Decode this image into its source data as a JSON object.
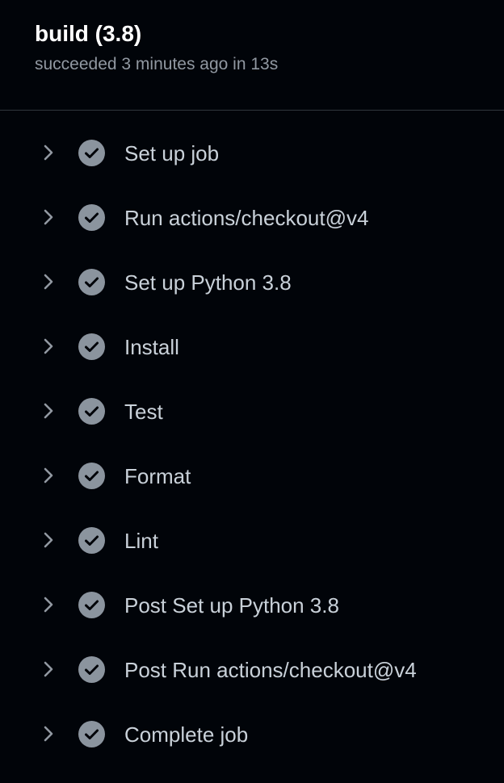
{
  "job": {
    "title": "build (3.8)",
    "status": "succeeded 3 minutes ago in 13s"
  },
  "colors": {
    "background": "#010409",
    "divider": "#30363d",
    "step_text": "#c9d1d9",
    "check_icon": "#8b949e",
    "chevron": "#9198a1"
  },
  "steps": [
    {
      "label": "Set up job",
      "status": "success",
      "icon": "check-circle-icon",
      "expand_icon": "chevron-right-icon"
    },
    {
      "label": "Run actions/checkout@v4",
      "status": "success",
      "icon": "check-circle-icon",
      "expand_icon": "chevron-right-icon"
    },
    {
      "label": "Set up Python 3.8",
      "status": "success",
      "icon": "check-circle-icon",
      "expand_icon": "chevron-right-icon"
    },
    {
      "label": "Install",
      "status": "success",
      "icon": "check-circle-icon",
      "expand_icon": "chevron-right-icon"
    },
    {
      "label": "Test",
      "status": "success",
      "icon": "check-circle-icon",
      "expand_icon": "chevron-right-icon"
    },
    {
      "label": "Format",
      "status": "success",
      "icon": "check-circle-icon",
      "expand_icon": "chevron-right-icon"
    },
    {
      "label": "Lint",
      "status": "success",
      "icon": "check-circle-icon",
      "expand_icon": "chevron-right-icon"
    },
    {
      "label": "Post Set up Python 3.8",
      "status": "success",
      "icon": "check-circle-icon",
      "expand_icon": "chevron-right-icon"
    },
    {
      "label": "Post Run actions/checkout@v4",
      "status": "success",
      "icon": "check-circle-icon",
      "expand_icon": "chevron-right-icon"
    },
    {
      "label": "Complete job",
      "status": "success",
      "icon": "check-circle-icon",
      "expand_icon": "chevron-right-icon"
    }
  ]
}
